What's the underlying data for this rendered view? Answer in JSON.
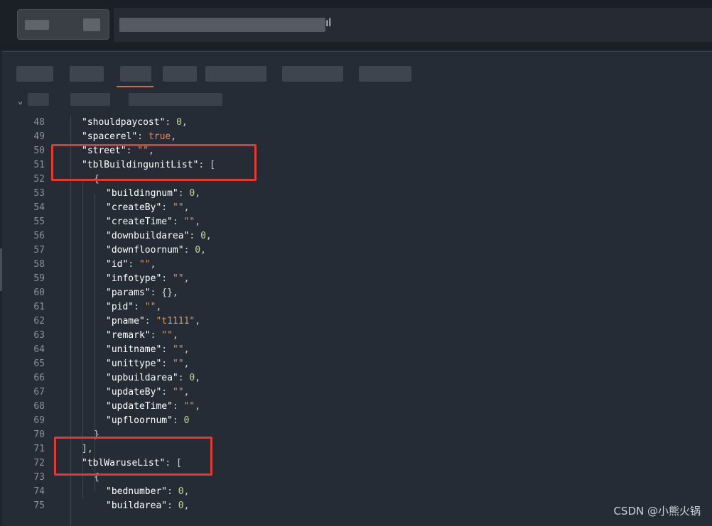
{
  "request": {
    "url_suffix": "ıl"
  },
  "editor": {
    "lines": [
      {
        "n": "48",
        "indent": 1,
        "parts": [
          [
            "k",
            "\"shouldpaycost\""
          ],
          [
            "p",
            ": "
          ],
          [
            "n",
            "0"
          ],
          [
            "p",
            ","
          ]
        ]
      },
      {
        "n": "49",
        "indent": 1,
        "parts": [
          [
            "k",
            "\"spacerel\""
          ],
          [
            "p",
            ": "
          ],
          [
            "b",
            "true"
          ],
          [
            "p",
            ","
          ]
        ]
      },
      {
        "n": "50",
        "indent": 1,
        "parts": [
          [
            "k",
            "\"street\""
          ],
          [
            "p",
            ": "
          ],
          [
            "s",
            "\"\""
          ],
          [
            "p",
            ","
          ]
        ]
      },
      {
        "n": "51",
        "indent": 1,
        "parts": [
          [
            "k",
            "\"tblBuildingunitList\""
          ],
          [
            "p",
            ": ["
          ]
        ]
      },
      {
        "n": "52",
        "indent": 2,
        "parts": [
          [
            "p",
            "{"
          ]
        ]
      },
      {
        "n": "53",
        "indent": 3,
        "parts": [
          [
            "k",
            "\"buildingnum\""
          ],
          [
            "p",
            ": "
          ],
          [
            "n",
            "0"
          ],
          [
            "p",
            ","
          ]
        ]
      },
      {
        "n": "54",
        "indent": 3,
        "parts": [
          [
            "k",
            "\"createBy\""
          ],
          [
            "p",
            ": "
          ],
          [
            "s",
            "\"\""
          ],
          [
            "p",
            ","
          ]
        ]
      },
      {
        "n": "55",
        "indent": 3,
        "parts": [
          [
            "k",
            "\"createTime\""
          ],
          [
            "p",
            ": "
          ],
          [
            "s",
            "\"\""
          ],
          [
            "p",
            ","
          ]
        ]
      },
      {
        "n": "56",
        "indent": 3,
        "parts": [
          [
            "k",
            "\"downbuildarea\""
          ],
          [
            "p",
            ": "
          ],
          [
            "n",
            "0"
          ],
          [
            "p",
            ","
          ]
        ]
      },
      {
        "n": "57",
        "indent": 3,
        "parts": [
          [
            "k",
            "\"downfloornum\""
          ],
          [
            "p",
            ": "
          ],
          [
            "n",
            "0"
          ],
          [
            "p",
            ","
          ]
        ]
      },
      {
        "n": "58",
        "indent": 3,
        "parts": [
          [
            "k",
            "\"id\""
          ],
          [
            "p",
            ": "
          ],
          [
            "s",
            "\"\""
          ],
          [
            "p",
            ","
          ]
        ]
      },
      {
        "n": "59",
        "indent": 3,
        "parts": [
          [
            "k",
            "\"infotype\""
          ],
          [
            "p",
            ": "
          ],
          [
            "s",
            "\"\""
          ],
          [
            "p",
            ","
          ]
        ]
      },
      {
        "n": "60",
        "indent": 3,
        "parts": [
          [
            "k",
            "\"params\""
          ],
          [
            "p",
            ": {},"
          ]
        ]
      },
      {
        "n": "61",
        "indent": 3,
        "parts": [
          [
            "k",
            "\"pid\""
          ],
          [
            "p",
            ": "
          ],
          [
            "s",
            "\"\""
          ],
          [
            "p",
            ","
          ]
        ]
      },
      {
        "n": "62",
        "indent": 3,
        "parts": [
          [
            "k",
            "\"pname\""
          ],
          [
            "p",
            ": "
          ],
          [
            "s",
            "\"t1111\""
          ],
          [
            "p",
            ","
          ]
        ]
      },
      {
        "n": "63",
        "indent": 3,
        "parts": [
          [
            "k",
            "\"remark\""
          ],
          [
            "p",
            ": "
          ],
          [
            "s",
            "\"\""
          ],
          [
            "p",
            ","
          ]
        ]
      },
      {
        "n": "64",
        "indent": 3,
        "parts": [
          [
            "k",
            "\"unitname\""
          ],
          [
            "p",
            ": "
          ],
          [
            "s",
            "\"\""
          ],
          [
            "p",
            ","
          ]
        ]
      },
      {
        "n": "65",
        "indent": 3,
        "parts": [
          [
            "k",
            "\"unittype\""
          ],
          [
            "p",
            ": "
          ],
          [
            "s",
            "\"\""
          ],
          [
            "p",
            ","
          ]
        ]
      },
      {
        "n": "66",
        "indent": 3,
        "parts": [
          [
            "k",
            "\"upbuildarea\""
          ],
          [
            "p",
            ": "
          ],
          [
            "n",
            "0"
          ],
          [
            "p",
            ","
          ]
        ]
      },
      {
        "n": "67",
        "indent": 3,
        "parts": [
          [
            "k",
            "\"updateBy\""
          ],
          [
            "p",
            ": "
          ],
          [
            "s",
            "\"\""
          ],
          [
            "p",
            ","
          ]
        ]
      },
      {
        "n": "68",
        "indent": 3,
        "parts": [
          [
            "k",
            "\"updateTime\""
          ],
          [
            "p",
            ": "
          ],
          [
            "s",
            "\"\""
          ],
          [
            "p",
            ","
          ]
        ]
      },
      {
        "n": "69",
        "indent": 3,
        "parts": [
          [
            "k",
            "\"upfloornum\""
          ],
          [
            "p",
            ": "
          ],
          [
            "n",
            "0"
          ]
        ]
      },
      {
        "n": "70",
        "indent": 2,
        "parts": [
          [
            "p",
            "}"
          ]
        ]
      },
      {
        "n": "71",
        "indent": 1,
        "parts": [
          [
            "p",
            "],"
          ]
        ]
      },
      {
        "n": "72",
        "indent": 1,
        "parts": [
          [
            "k",
            "\"tblWaruseList\""
          ],
          [
            "p",
            ": ["
          ]
        ]
      },
      {
        "n": "73",
        "indent": 2,
        "parts": [
          [
            "p",
            "{"
          ]
        ]
      },
      {
        "n": "74",
        "indent": 3,
        "parts": [
          [
            "k",
            "\"bednumber\""
          ],
          [
            "p",
            ": "
          ],
          [
            "n",
            "0"
          ],
          [
            "p",
            ","
          ]
        ]
      },
      {
        "n": "75",
        "indent": 3,
        "parts": [
          [
            "k",
            "\"buildarea\""
          ],
          [
            "p",
            ": "
          ],
          [
            "n",
            "0"
          ],
          [
            "p",
            ","
          ]
        ]
      }
    ]
  },
  "watermark": "CSDN @小熊火锅",
  "colors": {
    "highlight": "#e03a32",
    "tab_active": "#e0672e"
  }
}
